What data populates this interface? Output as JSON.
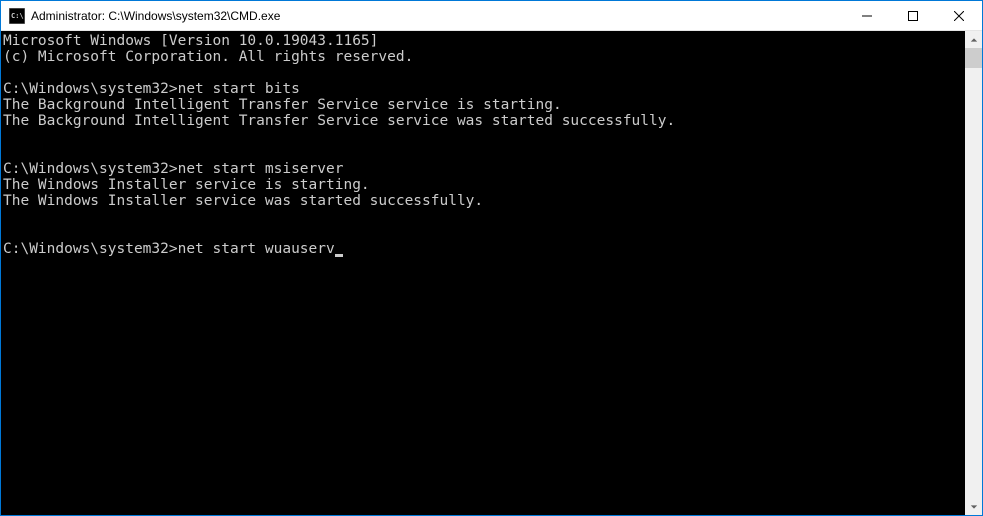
{
  "titlebar": {
    "title": "Administrator: C:\\Windows\\system32\\CMD.exe"
  },
  "terminal": {
    "lines": [
      "Microsoft Windows [Version 10.0.19043.1165]",
      "(c) Microsoft Corporation. All rights reserved.",
      "",
      "C:\\Windows\\system32>net start bits",
      "The Background Intelligent Transfer Service service is starting.",
      "The Background Intelligent Transfer Service service was started successfully.",
      "",
      "",
      "C:\\Windows\\system32>net start msiserver",
      "The Windows Installer service is starting.",
      "The Windows Installer service was started successfully.",
      "",
      "",
      "C:\\Windows\\system32>net start wuauserv"
    ],
    "current_prompt": "C:\\Windows\\system32>",
    "current_command": "net start wuauserv"
  }
}
